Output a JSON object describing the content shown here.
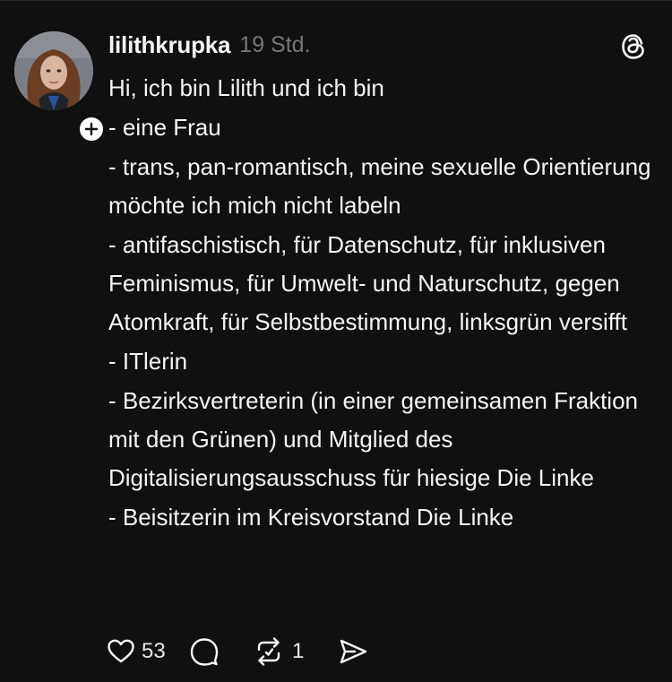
{
  "post": {
    "username": "lilithkrupka",
    "timestamp": "19 Std.",
    "lines": [
      "Hi, ich bin Lilith und ich bin",
      "- eine Frau",
      "- trans, pan-romantisch, meine sexuelle Orientierung möchte ich mich nicht labeln",
      "- antifaschistisch, für Datenschutz, für inklusiven Feminismus, für Umwelt- und Naturschutz, gegen Atomkraft, für Selbstbestimmung, linksgrün versifft",
      "- ITlerin",
      "- Bezirksvertreterin (in einer gemeinsamen Fraktion mit den Grünen) und Mitglied des Digitalisierungsausschuss für hiesige Die Linke",
      "- Beisitzerin im Kreisvorstand Die Linke"
    ],
    "actions": {
      "likes": "53",
      "reposts": "1"
    }
  },
  "icons": {
    "avatar": "profile-photo",
    "follow": "plus-icon",
    "logo": "threads-logo-icon",
    "like": "heart-icon",
    "reply": "comment-bubble-icon",
    "repost": "repost-icon",
    "share": "send-icon"
  },
  "colors": {
    "background": "#101010",
    "text": "#f3f5f7",
    "secondary": "#777777"
  }
}
